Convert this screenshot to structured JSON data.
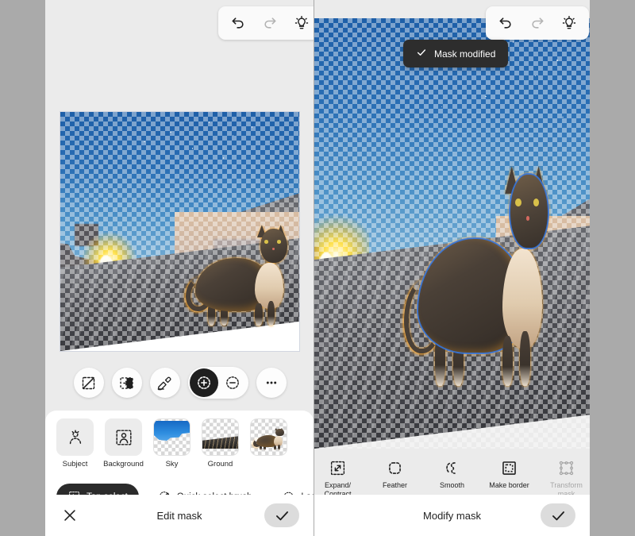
{
  "app": {
    "background_color": "#aaaaaa",
    "panel_background": "#ebebeb",
    "accent_selection_color": "#3278e6",
    "highlight_color": "#ffa828"
  },
  "left_panel": {
    "toolbar": {
      "undo": {
        "label": "Undo",
        "icon": "undo-icon",
        "enabled": true
      },
      "redo": {
        "label": "Redo",
        "icon": "redo-icon",
        "enabled": false
      },
      "hint": {
        "label": "Hints",
        "icon": "lightbulb-icon",
        "enabled": true
      }
    },
    "canvas": {
      "alt": "Cat standing on a rooftop at dusk with checkerboard transparency over the masked sky and buildings"
    },
    "round_tools": [
      {
        "name": "deselect-tool",
        "icon": "deselect-icon",
        "label": "Deselect",
        "active": false
      },
      {
        "name": "invert-selection-tool",
        "icon": "invert-selection-icon",
        "label": "Invert selection",
        "active": false
      },
      {
        "name": "refine-mask-tool",
        "icon": "refine-brush-icon",
        "label": "Refine mask",
        "active": false
      }
    ],
    "mode_pill": [
      {
        "name": "add-to-selection",
        "icon": "plus-circle-dashed-icon",
        "label": "Add",
        "active": true
      },
      {
        "name": "subtract-from-selection",
        "icon": "minus-circle-dashed-icon",
        "label": "Subtract",
        "active": false
      }
    ],
    "overflow": {
      "name": "more-options",
      "icon": "more-horizontal-icon",
      "label": "More"
    },
    "thumbnails": [
      {
        "label": "Subject",
        "kind": "icon",
        "icon": "subject-person-icon"
      },
      {
        "label": "Background",
        "kind": "icon",
        "icon": "background-person-icon"
      },
      {
        "label": "Sky",
        "kind": "image",
        "icon": "sky-thumbnail"
      },
      {
        "label": "Ground",
        "kind": "image",
        "icon": "ground-thumbnail"
      },
      {
        "label": "",
        "kind": "image",
        "icon": "cat-thumbnail"
      }
    ],
    "modes": [
      {
        "label": "Tap select",
        "icon": "tap-select-icon",
        "active": true
      },
      {
        "label": "Quick select brush",
        "icon": "quick-select-brush-icon",
        "active": false
      },
      {
        "label": "Lasso",
        "icon": "lasso-icon",
        "active": false
      },
      {
        "label": "",
        "icon": "rectangle-select-icon",
        "active": false
      }
    ],
    "action_bar": {
      "close_label": "Close",
      "close_icon": "close-x-icon",
      "title": "Edit mask",
      "confirm_label": "Apply",
      "confirm_icon": "checkmark-icon"
    }
  },
  "right_panel": {
    "toolbar": {
      "undo": {
        "label": "Undo",
        "icon": "undo-icon",
        "enabled": true
      },
      "redo": {
        "label": "Redo",
        "icon": "redo-icon",
        "enabled": false
      },
      "hint": {
        "label": "Hints",
        "icon": "lightbulb-icon",
        "enabled": true
      }
    },
    "toast": {
      "icon": "checkmark-icon",
      "message": "Mask modified"
    },
    "canvas": {
      "alt": "Zoomed view of the cat with a blue selection outline over a checkerboard transparency background"
    },
    "modify_tools": [
      {
        "label": "Expand/\nContract",
        "line1": "Expand/",
        "line2": "Contract",
        "icon": "expand-contract-icon",
        "enabled": true
      },
      {
        "label": "Feather",
        "line1": "Feather",
        "line2": "",
        "icon": "feather-icon",
        "enabled": true
      },
      {
        "label": "Smooth",
        "line1": "Smooth",
        "line2": "",
        "icon": "smooth-icon",
        "enabled": true
      },
      {
        "label": "Make border",
        "line1": "Make border",
        "line2": "",
        "icon": "make-border-icon",
        "enabled": true
      },
      {
        "label": "Transform mask",
        "line1": "Transform",
        "line2": "mask",
        "icon": "transform-mask-icon",
        "enabled": false
      }
    ],
    "action_bar": {
      "title": "Modify mask",
      "confirm_label": "Apply",
      "confirm_icon": "checkmark-icon"
    }
  }
}
